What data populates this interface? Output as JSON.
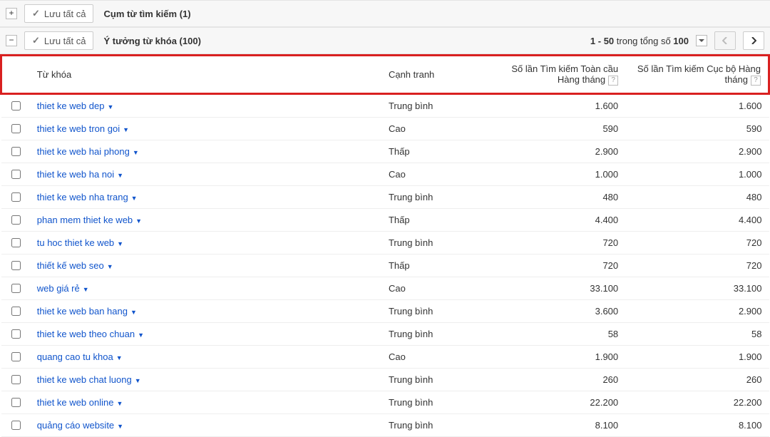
{
  "panel1": {
    "expand": "+",
    "save_all": "Lưu tất cả",
    "title": "Cụm từ tìm kiếm (1)"
  },
  "panel2": {
    "expand": "−",
    "save_all": "Lưu tất cả",
    "title": "Ý tưởng từ khóa (100)",
    "pager_range": "1 - 50",
    "pager_mid": " trong tổng số ",
    "pager_total": "100"
  },
  "columns": {
    "keyword": "Từ khóa",
    "competition": "Cạnh tranh",
    "global": "Số lần Tìm kiếm Toàn cầu Hàng tháng",
    "local": "Số lần Tìm kiếm Cục bộ Hàng tháng"
  },
  "rows": [
    {
      "kw": "thiet ke web dep",
      "comp": "Trung bình",
      "g": "1.600",
      "l": "1.600"
    },
    {
      "kw": "thiet ke web tron goi",
      "comp": "Cao",
      "g": "590",
      "l": "590"
    },
    {
      "kw": "thiet ke web hai phong",
      "comp": "Thấp",
      "g": "2.900",
      "l": "2.900"
    },
    {
      "kw": "thiet ke web ha noi",
      "comp": "Cao",
      "g": "1.000",
      "l": "1.000"
    },
    {
      "kw": "thiet ke web nha trang",
      "comp": "Trung bình",
      "g": "480",
      "l": "480"
    },
    {
      "kw": "phan mem thiet ke web",
      "comp": "Thấp",
      "g": "4.400",
      "l": "4.400"
    },
    {
      "kw": "tu hoc thiet ke web",
      "comp": "Trung bình",
      "g": "720",
      "l": "720"
    },
    {
      "kw": "thiết kế web seo",
      "comp": "Thấp",
      "g": "720",
      "l": "720"
    },
    {
      "kw": "web giá rẻ",
      "comp": "Cao",
      "g": "33.100",
      "l": "33.100"
    },
    {
      "kw": "thiet ke web ban hang",
      "comp": "Trung bình",
      "g": "3.600",
      "l": "2.900"
    },
    {
      "kw": "thiet ke web theo chuan",
      "comp": "Trung bình",
      "g": "58",
      "l": "58"
    },
    {
      "kw": "quang cao tu khoa",
      "comp": "Cao",
      "g": "1.900",
      "l": "1.900"
    },
    {
      "kw": "thiet ke web chat luong",
      "comp": "Trung bình",
      "g": "260",
      "l": "260"
    },
    {
      "kw": "thiet ke web online",
      "comp": "Trung bình",
      "g": "22.200",
      "l": "22.200"
    },
    {
      "kw": "quảng cáo website",
      "comp": "Trung bình",
      "g": "8.100",
      "l": "8.100"
    }
  ]
}
